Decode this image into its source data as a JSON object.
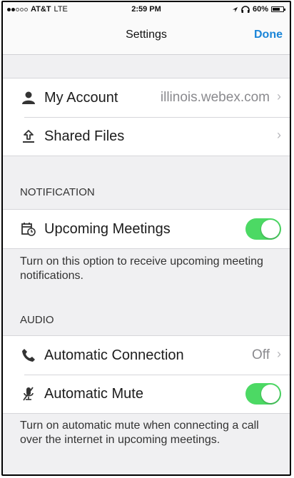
{
  "status_bar": {
    "carrier": "AT&T",
    "network": "LTE",
    "time": "2:59 PM",
    "battery": "60%",
    "signal_bars_filled": 2,
    "signal_bars_total": 5
  },
  "nav": {
    "title": "Settings",
    "done_label": "Done",
    "accent_color": "#1a85d8"
  },
  "account_group": {
    "my_account_label": "My Account",
    "my_account_value": "illinois.webex.com",
    "shared_files_label": "Shared Files"
  },
  "notification": {
    "header": "NOTIFICATION",
    "upcoming_meetings_label": "Upcoming Meetings",
    "upcoming_meetings_on": true,
    "note": "Turn on this option to receive upcoming meeting notifications."
  },
  "audio": {
    "header": "AUDIO",
    "automatic_connection_label": "Automatic Connection",
    "automatic_connection_value": "Off",
    "automatic_mute_label": "Automatic Mute",
    "automatic_mute_on": true,
    "note": "Turn on automatic mute when connecting a call over the internet in upcoming meetings."
  },
  "icons": {
    "account": "person-icon",
    "shared_files": "upload-icon",
    "upcoming_meetings": "calendar-clock-icon",
    "automatic_connection": "phone-icon",
    "automatic_mute": "mic-muted-icon",
    "chevron": "chevron-right-icon"
  },
  "toggle_on_color": "#4cd964"
}
